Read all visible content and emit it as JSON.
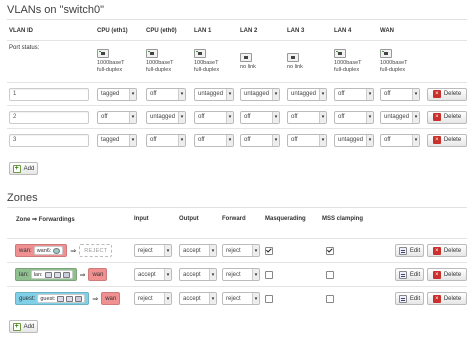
{
  "vlans": {
    "title": "VLANs on \"switch0\"",
    "headers": [
      "VLAN ID",
      "CPU (eth1)",
      "CPU (eth0)",
      "LAN 1",
      "LAN 2",
      "LAN 3",
      "LAN 4",
      "WAN"
    ],
    "port_status_label": "Port status:",
    "ports": [
      {
        "line1": "1000baseT",
        "line2": "full-duplex",
        "icon": "ethernet-port-up-icon"
      },
      {
        "line1": "1000baseT",
        "line2": "full-duplex",
        "icon": "ethernet-port-up-icon"
      },
      {
        "line1": "100baseT",
        "line2": "full-duplex",
        "icon": "ethernet-port-up-icon"
      },
      {
        "line1": "no link",
        "line2": "",
        "icon": "ethernet-port-down-icon"
      },
      {
        "line1": "no link",
        "line2": "",
        "icon": "ethernet-port-down-icon"
      },
      {
        "line1": "1000baseT",
        "line2": "full-duplex",
        "icon": "ethernet-port-up-icon"
      },
      {
        "line1": "1000baseT",
        "line2": "full-duplex",
        "icon": "ethernet-port-up-icon"
      }
    ],
    "rows": [
      {
        "id": "1",
        "cells": [
          "tagged",
          "off",
          "untagged",
          "untagged",
          "untagged",
          "off",
          "off"
        ]
      },
      {
        "id": "2",
        "cells": [
          "off",
          "untagged",
          "off",
          "off",
          "off",
          "off",
          "untagged"
        ]
      },
      {
        "id": "3",
        "cells": [
          "tagged",
          "off",
          "off",
          "off",
          "off",
          "untagged",
          "off"
        ]
      }
    ],
    "delete_label": "Delete",
    "add_label": "Add"
  },
  "zones": {
    "title": "Zones",
    "headers": [
      "Zone ⇒ Forwardings",
      "Input",
      "Output",
      "Forward",
      "Masquerading",
      "MSS clamping"
    ],
    "rows": [
      {
        "name": "wan:",
        "iface": "wan6:",
        "iface_icons": [
          "network-icon"
        ],
        "dest": "REJECT",
        "dest_kind": "reject",
        "badge_color": "#f09090",
        "input": "reject",
        "output": "accept",
        "forward": "reject",
        "masq": true,
        "mss": true
      },
      {
        "name": "lan:",
        "iface": "lan:",
        "iface_icons": [
          "ethernet-icon",
          "ethernet-icon",
          "wireless-icon"
        ],
        "dest": "wan",
        "dest_kind": "zone",
        "badge_color": "#90c090",
        "input": "accept",
        "output": "accept",
        "forward": "reject",
        "masq": false,
        "mss": false
      },
      {
        "name": "guest:",
        "iface": "guest:",
        "iface_icons": [
          "ethernet-icon",
          "ethernet-icon",
          "wireless-icon"
        ],
        "dest": "wan",
        "dest_kind": "zone",
        "badge_color": "#80d0e8",
        "input": "reject",
        "output": "accept",
        "forward": "reject",
        "masq": false,
        "mss": false
      }
    ],
    "wan_dest_color": "#f09090",
    "edit_label": "Edit",
    "delete_label": "Delete",
    "add_label": "Add"
  }
}
